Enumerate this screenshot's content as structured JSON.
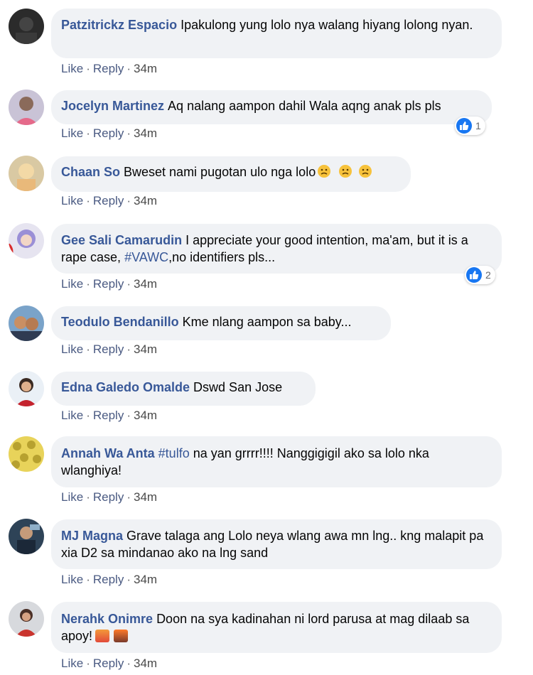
{
  "ui": {
    "like_label": "Like",
    "reply_label": "Reply",
    "separator": "·"
  },
  "comments": [
    {
      "author": "Patzitrickz Espacio",
      "text": "Ipakulong yung lolo nya walang hiyang lolong nyan.",
      "time": "34m"
    },
    {
      "author": "Jocelyn Martinez",
      "text": "Aq nalang aampon dahil Wala aqng anak pls pls",
      "time": "34m",
      "reactions": "1"
    },
    {
      "author": "Chaan So",
      "text": "Bweset nami pugotan ulo nga lolo",
      "time": "34m"
    },
    {
      "author": "Gee Sali Camarudin",
      "text_before": "I appreciate your good intention, ma'am, but it is a rape case, ",
      "hashtag": "#VAWC",
      "text_after": ",no identifiers pls...",
      "time": "34m",
      "reactions": "2"
    },
    {
      "author": "Teodulo Bendanillo",
      "text": "Kme nlang aampon sa baby...",
      "time": "34m"
    },
    {
      "author": "Edna Galedo Omalde",
      "text": "Dswd San Jose",
      "time": "34m"
    },
    {
      "author": "Annah Wa Anta",
      "hashtag": "#tulfo",
      "text_after": " na yan grrrr!!!! Nanggigigil ako sa lolo nka wlanghiya!",
      "time": "34m"
    },
    {
      "author": "MJ Magna",
      "text": "Grave talaga ang Lolo neya wlang awa mn lng.. kng malapit pa xia D2 sa mindanao ako na lng sand",
      "time": "34m"
    },
    {
      "author": "Nerahk Onimre",
      "text": "Doon na sya kadinahan ni lord parusa at mag dilaab sa apoy!",
      "time": "34m"
    }
  ]
}
